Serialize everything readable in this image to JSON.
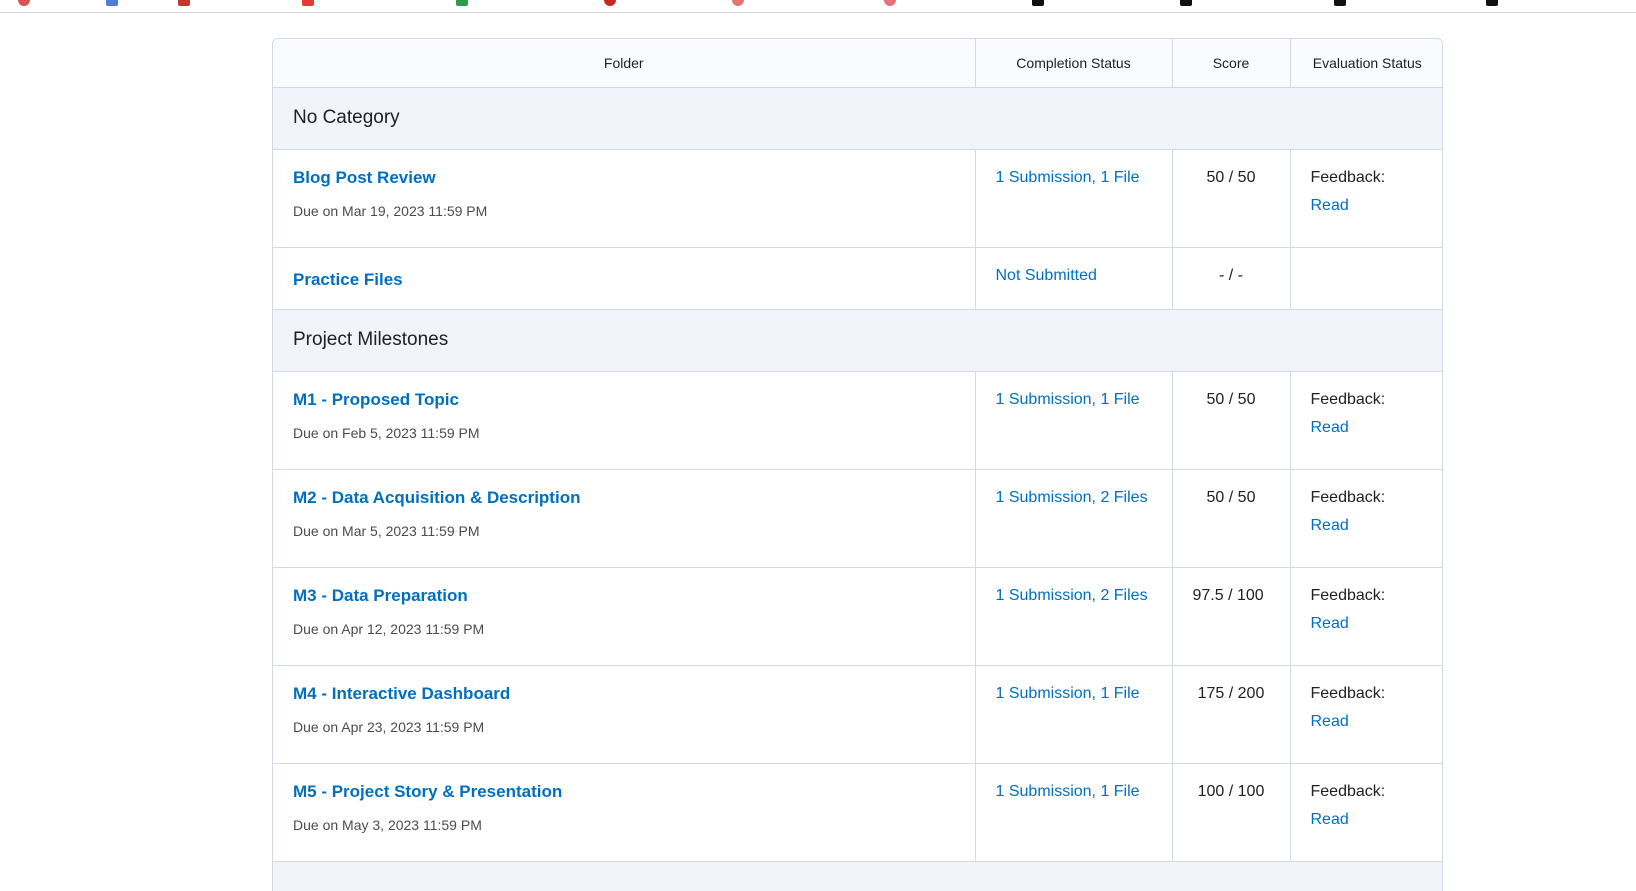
{
  "table": {
    "headers": {
      "folder": "Folder",
      "completion": "Completion Status",
      "score": "Score",
      "evaluation": "Evaluation Status"
    },
    "categories": [
      {
        "name": "No Category",
        "items": [
          {
            "title": "Blog Post Review",
            "due": "Due on Mar 19, 2023 11:59 PM",
            "completion": "1 Submission, 1 File",
            "score": "50 / 50",
            "feedback_label": "Feedback:",
            "feedback_link": "Read"
          },
          {
            "title": "Practice Files",
            "due": "",
            "completion": "Not Submitted",
            "score": "- / -",
            "feedback_label": "",
            "feedback_link": ""
          }
        ]
      },
      {
        "name": "Project Milestones",
        "items": [
          {
            "title": "M1 - Proposed Topic",
            "due": "Due on Feb 5, 2023 11:59 PM",
            "completion": "1 Submission, 1 File",
            "score": "50 / 50",
            "feedback_label": "Feedback:",
            "feedback_link": "Read"
          },
          {
            "title": "M2 - Data Acquisition & Description",
            "due": "Due on Mar 5, 2023 11:59 PM",
            "completion": "1 Submission, 2 Files",
            "score": "50 / 50",
            "feedback_label": "Feedback:",
            "feedback_link": "Read"
          },
          {
            "title": "M3 - Data Preparation",
            "due": "Due on Apr 12, 2023 11:59 PM",
            "completion": "1 Submission, 2 Files",
            "score": "97.5 / 100",
            "feedback_label": "Feedback:",
            "feedback_link": "Read"
          },
          {
            "title": "M4 - Interactive Dashboard",
            "due": "Due on Apr 23, 2023 11:59 PM",
            "completion": "1 Submission, 1 File",
            "score": "175 / 200",
            "feedback_label": "Feedback:",
            "feedback_link": "Read"
          },
          {
            "title": "M5 - Project Story & Presentation",
            "due": "Due on May 3, 2023 11:59 PM",
            "completion": "1 Submission, 1 File",
            "score": "100 / 100",
            "feedback_label": "Feedback:",
            "feedback_link": "Read"
          }
        ]
      }
    ]
  },
  "colors": {
    "link": "#006fbf",
    "category_bg": "#f1f5fb",
    "border": "#d3d9e3"
  }
}
